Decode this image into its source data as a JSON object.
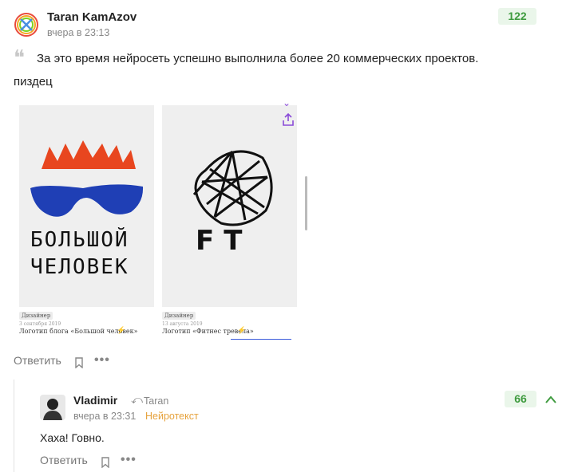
{
  "comment": {
    "author": "Taran KamAzov",
    "time": "вчера в 23:13",
    "score": "122",
    "quote": "За это время нейросеть успешно выполнила более 20 коммерческих проектов.",
    "text": "пиздец",
    "reply_label": "Ответить",
    "cards": [
      {
        "tag": "Дизайнер",
        "date": "3 сентября 2019",
        "title": "Логотип блога «Большой человек»",
        "logo_text_1": "БОЛЬШОЙ",
        "logo_text_2": "ЧЕЛОВЕК"
      },
      {
        "tag": "Дизайнер",
        "date": "13 августа 2019",
        "title": "Логотип «Фитнес тревела»",
        "logo_text": "FT"
      }
    ]
  },
  "reply": {
    "author": "Vladimir",
    "reply_to": "Taran",
    "time": "вчера в 23:31",
    "badge": "Нейротекст",
    "score": "66",
    "text": "Хаха! Говно.",
    "reply_label": "Ответить"
  },
  "colors": {
    "score_bg": "#eaf6ea",
    "score_text": "#3f9b3f",
    "badge": "#e6a23c",
    "accent_purple": "#8a4bd8"
  }
}
